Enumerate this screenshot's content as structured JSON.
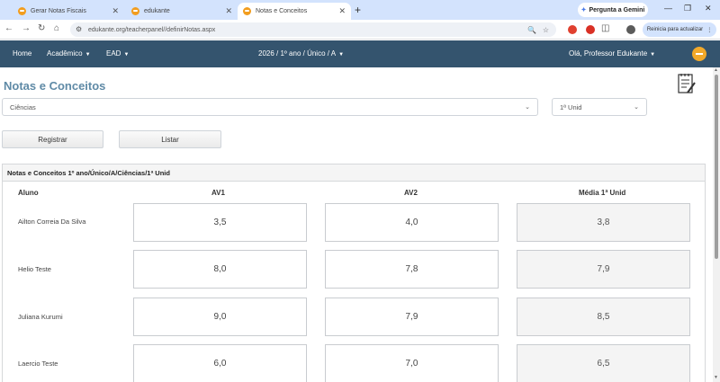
{
  "browser": {
    "tabs": [
      {
        "label": "Gerar Notas Fiscais"
      },
      {
        "label": "edukante"
      },
      {
        "label": "Notas e Conceitos"
      }
    ],
    "new_tab": "+",
    "gemini_label": "Pergunta a Gemini",
    "url": "edukante.org/teacherpanel//definirNotas.aspx",
    "relaunch_label": "Reinicia para actualizar"
  },
  "nav": {
    "home": "Home",
    "academico": "Acadêmico",
    "ead": "EAD",
    "context": "2026 / 1º ano / Único / A",
    "greeting": "Olá, Professor Edukante"
  },
  "page": {
    "title": "Notas e Conceitos",
    "subject_select": "Ciências",
    "unit_select": "1ª Unid",
    "register_button": "Registrar",
    "list_button": "Listar"
  },
  "grades": {
    "panel_title": "Notas e Conceitos 1º ano/Único/A/Ciências/1ª Unid",
    "columns": [
      "Aluno",
      "AV1",
      "AV2",
      "Média 1ª Unid"
    ],
    "rows": [
      {
        "name": "Ailton Correia Da Silva",
        "av1": "3,5",
        "av2": "4,0",
        "avg": "3,8"
      },
      {
        "name": "Helio Teste",
        "av1": "8,0",
        "av2": "7,8",
        "avg": "7,9"
      },
      {
        "name": "Juliana Kurumi",
        "av1": "9,0",
        "av2": "7,9",
        "avg": "8,5"
      },
      {
        "name": "Laercio Teste",
        "av1": "6,0",
        "av2": "7,0",
        "avg": "6,5"
      }
    ]
  },
  "colors": {
    "nav_bg": "#34546e",
    "title": "#5f8aa6",
    "tabstrip": "#d3e3fd",
    "logo": "#f2a92a"
  }
}
